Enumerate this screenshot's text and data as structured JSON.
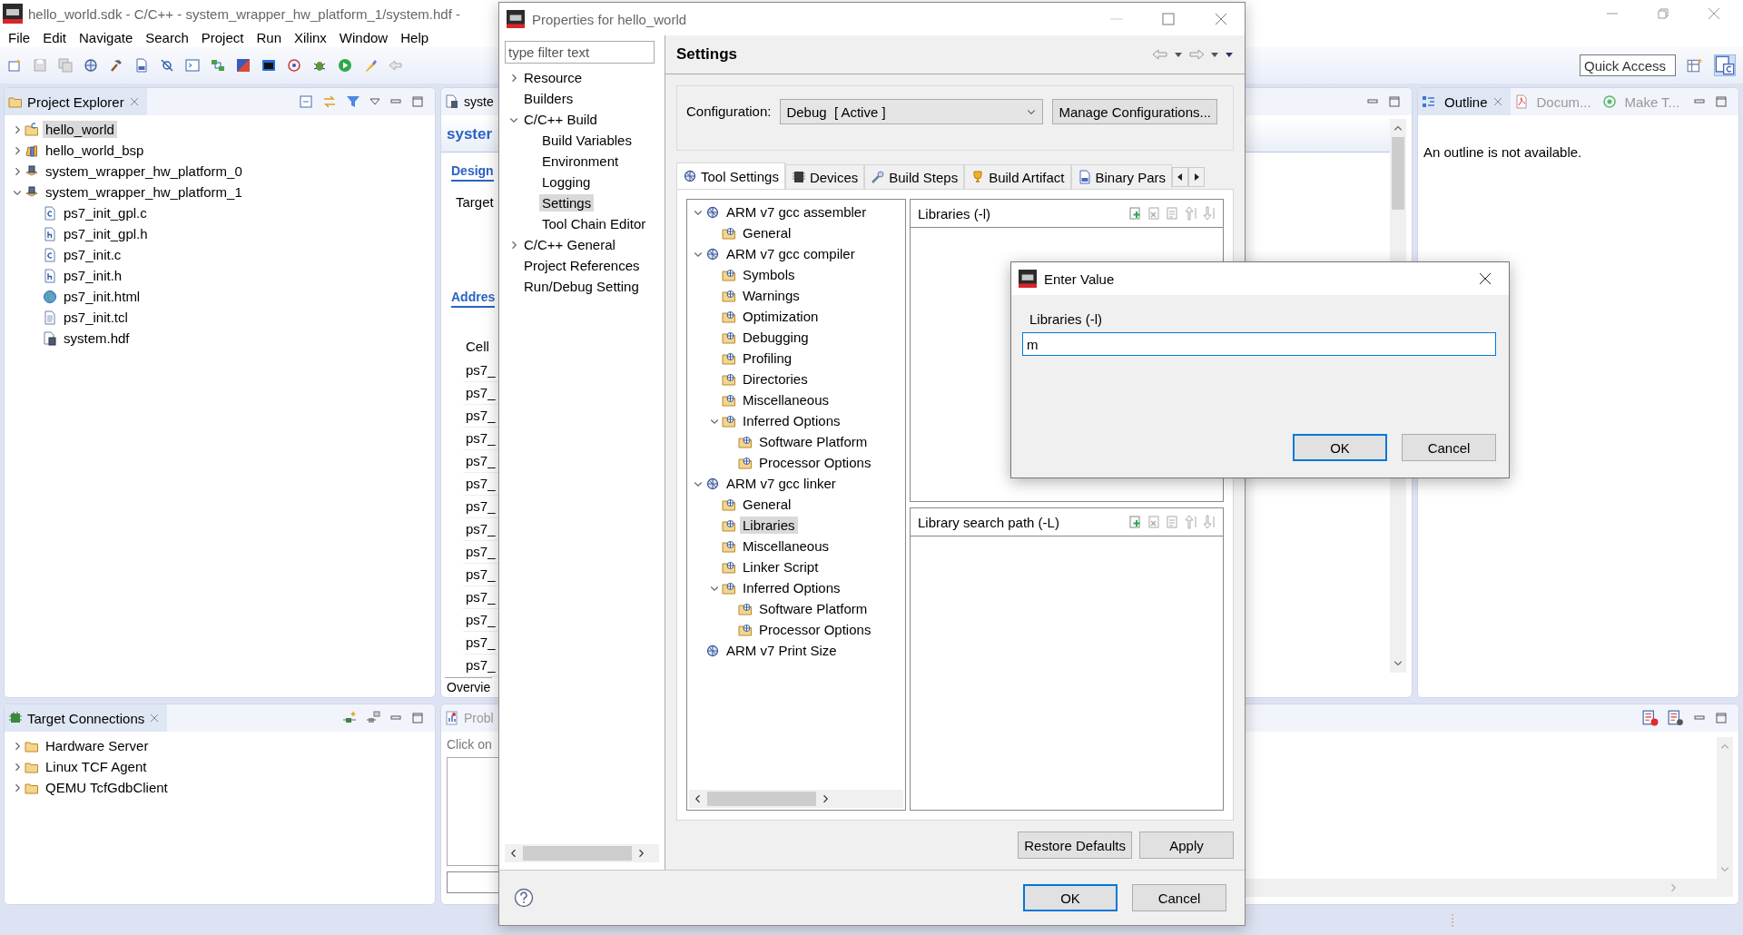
{
  "window": {
    "title": "hello_world.sdk - C/C++ - system_wrapper_hw_platform_1/system.hdf -"
  },
  "menu": [
    "File",
    "Edit",
    "Navigate",
    "Search",
    "Project",
    "Run",
    "Xilinx",
    "Window",
    "Help"
  ],
  "quick_access": {
    "placeholder": "Quick Access"
  },
  "project_explorer": {
    "title": "Project Explorer",
    "tree": [
      {
        "label": "hello_world",
        "kind": "project",
        "expanded": false,
        "selected": true
      },
      {
        "label": "hello_world_bsp",
        "kind": "bsp",
        "expanded": false,
        "selected": false
      },
      {
        "label": "system_wrapper_hw_platform_0",
        "kind": "platform",
        "expanded": false,
        "selected": false
      },
      {
        "label": "system_wrapper_hw_platform_1",
        "kind": "platform",
        "expanded": true,
        "selected": false,
        "children": [
          {
            "label": "ps7_init_gpl.c",
            "kind": "c-file",
            "selected": false
          },
          {
            "label": "ps7_init_gpl.h",
            "kind": "h-file",
            "selected": false
          },
          {
            "label": "ps7_init.c",
            "kind": "c-file",
            "selected": false
          },
          {
            "label": "ps7_init.h",
            "kind": "h-file",
            "selected": false
          },
          {
            "label": "ps7_init.html",
            "kind": "html-file",
            "selected": false
          },
          {
            "label": "ps7_init.tcl",
            "kind": "text-file",
            "selected": false
          },
          {
            "label": "system.hdf",
            "kind": "hdf-file",
            "selected": false
          }
        ]
      }
    ]
  },
  "editor": {
    "tab": "syste",
    "heading": "syster",
    "design_tab": "Design",
    "target_label": "Target",
    "address_heading": "Addres",
    "column": "Cell",
    "rows": [
      "ps7_",
      "ps7_",
      "ps7_",
      "ps7_",
      "ps7_",
      "ps7_",
      "ps7_",
      "ps7_",
      "ps7_",
      "ps7_",
      "ps7_",
      "ps7_",
      "ps7_",
      "ps7_"
    ],
    "bottom_tab": "Overvie"
  },
  "outline": {
    "tabs": [
      {
        "label": "Outline",
        "kind": "outline",
        "selected": true
      },
      {
        "label": "Docum...",
        "kind": "pdf",
        "selected": false
      },
      {
        "label": "Make T...",
        "kind": "target",
        "selected": false
      }
    ],
    "message": "An outline is not available."
  },
  "target_connections": {
    "title": "Target Connections",
    "items": [
      {
        "label": "Hardware Server",
        "kind": "folder",
        "expanded": false,
        "selected": false
      },
      {
        "label": "Linux TCF Agent",
        "kind": "folder",
        "expanded": false,
        "selected": false
      },
      {
        "label": "QEMU TcfGdbClient",
        "kind": "folder",
        "expanded": false,
        "selected": false
      }
    ]
  },
  "problems": {
    "tab": "Probl",
    "text": "Click on"
  },
  "properties_dialog": {
    "title": "Properties for hello_world",
    "filter": {
      "placeholder": "type filter text"
    },
    "nav": [
      {
        "label": "Resource",
        "expanded": false,
        "selected": false
      },
      {
        "label": "Builders",
        "selected": false
      },
      {
        "label": "C/C++ Build",
        "expanded": true,
        "selected": false,
        "children": [
          {
            "label": "Build Variables",
            "selected": false
          },
          {
            "label": "Environment",
            "selected": false
          },
          {
            "label": "Logging",
            "selected": false
          },
          {
            "label": "Settings",
            "selected": true
          },
          {
            "label": "Tool Chain Editor",
            "selected": false
          }
        ]
      },
      {
        "label": "C/C++ General",
        "expanded": false,
        "selected": false
      },
      {
        "label": "Project References",
        "selected": false
      },
      {
        "label": "Run/Debug Setting",
        "selected": false
      }
    ],
    "page_title": "Settings",
    "configuration_label": "Configuration:",
    "configuration_value": "Debug  [ Active ]",
    "manage_button": "Manage Configurations...",
    "tabs": [
      {
        "label": "Tool Settings",
        "kind": "tool",
        "selected": true
      },
      {
        "label": "Devices",
        "kind": "device",
        "selected": false
      },
      {
        "label": "Build Steps",
        "kind": "steps",
        "selected": false
      },
      {
        "label": "Build Artifact",
        "kind": "artifact",
        "selected": false
      },
      {
        "label": "Binary Pars",
        "kind": "parser",
        "selected": false
      }
    ],
    "tool_tree": [
      {
        "label": "ARM v7 gcc assembler",
        "kind": "tool",
        "expanded": true,
        "selected": false,
        "children": [
          {
            "label": "General",
            "kind": "category",
            "selected": false
          }
        ]
      },
      {
        "label": "ARM v7 gcc compiler",
        "kind": "tool",
        "expanded": true,
        "selected": false,
        "children": [
          {
            "label": "Symbols",
            "kind": "category",
            "selected": false
          },
          {
            "label": "Warnings",
            "kind": "category",
            "selected": false
          },
          {
            "label": "Optimization",
            "kind": "category",
            "selected": false
          },
          {
            "label": "Debugging",
            "kind": "category",
            "selected": false
          },
          {
            "label": "Profiling",
            "kind": "category",
            "selected": false
          },
          {
            "label": "Directories",
            "kind": "category",
            "selected": false
          },
          {
            "label": "Miscellaneous",
            "kind": "category",
            "selected": false
          },
          {
            "label": "Inferred Options",
            "kind": "category",
            "expanded": true,
            "selected": false,
            "children": [
              {
                "label": "Software Platform",
                "kind": "category",
                "selected": false
              },
              {
                "label": "Processor Options",
                "kind": "category",
                "selected": false
              }
            ]
          }
        ]
      },
      {
        "label": "ARM v7 gcc linker",
        "kind": "tool",
        "expanded": true,
        "selected": false,
        "children": [
          {
            "label": "General",
            "kind": "category",
            "selected": false
          },
          {
            "label": "Libraries",
            "kind": "category",
            "selected": true
          },
          {
            "label": "Miscellaneous",
            "kind": "category",
            "selected": false
          },
          {
            "label": "Linker Script",
            "kind": "category",
            "selected": false
          },
          {
            "label": "Inferred Options",
            "kind": "category",
            "expanded": true,
            "selected": false,
            "children": [
              {
                "label": "Software Platform",
                "kind": "category",
                "selected": false
              },
              {
                "label": "Processor Options",
                "kind": "category",
                "selected": false
              }
            ]
          }
        ]
      },
      {
        "label": "ARM v7 Print Size",
        "kind": "tool",
        "selected": false
      }
    ],
    "lists": [
      {
        "title": "Libraries (-l)"
      },
      {
        "title": "Library search path (-L)"
      }
    ],
    "page_buttons": [
      "Restore Defaults",
      "Apply"
    ],
    "buttons": [
      {
        "label": "OK",
        "default": true
      },
      {
        "label": "Cancel",
        "default": false
      }
    ]
  },
  "enter_value_dialog": {
    "title": "Enter Value",
    "label": "Libraries (-l)",
    "value": "m",
    "buttons": [
      {
        "label": "OK",
        "default": true
      },
      {
        "label": "Cancel",
        "default": false
      }
    ]
  }
}
